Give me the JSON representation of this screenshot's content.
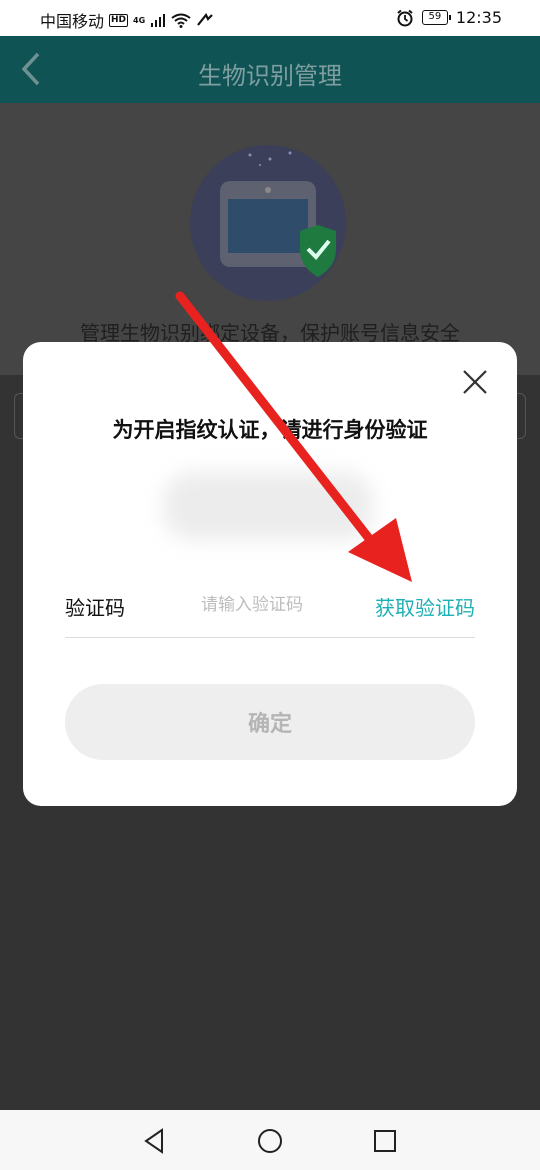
{
  "status_bar": {
    "carrier": "中国移动",
    "hd": "HD",
    "network": "4G",
    "battery": "59",
    "time": "12:35"
  },
  "app_bar": {
    "title": "生物识别管理"
  },
  "background_page": {
    "subtitle": "管理生物识别绑定设备，保护账号信息安全"
  },
  "dialog": {
    "title": "为开启指纹认证，请进行身份验证",
    "code_label": "验证码",
    "code_placeholder": "请输入验证码",
    "get_code_label": "获取验证码",
    "confirm_label": "确定"
  },
  "colors": {
    "accent": "#1fb0b6",
    "header": "#0f5355",
    "overlay": "#333333",
    "annotation_arrow": "#e8231f"
  },
  "icons": [
    "back-arrow-icon",
    "close-icon",
    "alarm-icon",
    "wifi-icon",
    "signal-icon",
    "nav-back-icon",
    "nav-home-icon",
    "nav-recents-icon"
  ]
}
